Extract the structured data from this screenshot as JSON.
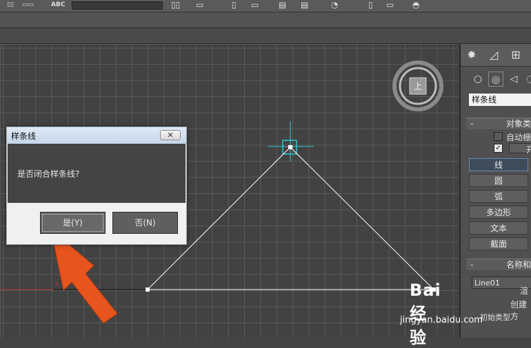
{
  "toolbar": {
    "text_icon_label": "ABC"
  },
  "viewport": {
    "viewcube_face_label": "上",
    "shape": "triangle",
    "colors": {
      "grid": "#5b5b5b",
      "background": "#424242",
      "spline": "#ffffff",
      "axis_red": "#c83232",
      "selection": "#2ec8d0",
      "arrow": "#e8541e"
    }
  },
  "command_panel": {
    "tabs": [
      "create-tab",
      "modify-tab",
      "hierarchy-tab"
    ],
    "category_dropdown": "样条线",
    "object_type_rollout": {
      "title": "对象类",
      "auto_grid_label": "自动栅",
      "start_new_shape_label": "开"
    },
    "buttons": [
      "线",
      "圆",
      "弧",
      "多边形",
      "文本",
      "截面"
    ],
    "active_button_index": 0,
    "name_rollout": {
      "title": "名称和",
      "name_value": "Line01"
    },
    "render_label": "渲",
    "create_method_label": "创建方",
    "initial_type_label": "初始类型"
  },
  "dialog": {
    "title": "样条线",
    "close_label": "✕",
    "message": "是否闭合样条线?",
    "yes_label": "是(Y)",
    "no_label": "否(N)"
  },
  "watermark": {
    "logo": "Bai经验",
    "url": "jingyan.baidu.com"
  }
}
